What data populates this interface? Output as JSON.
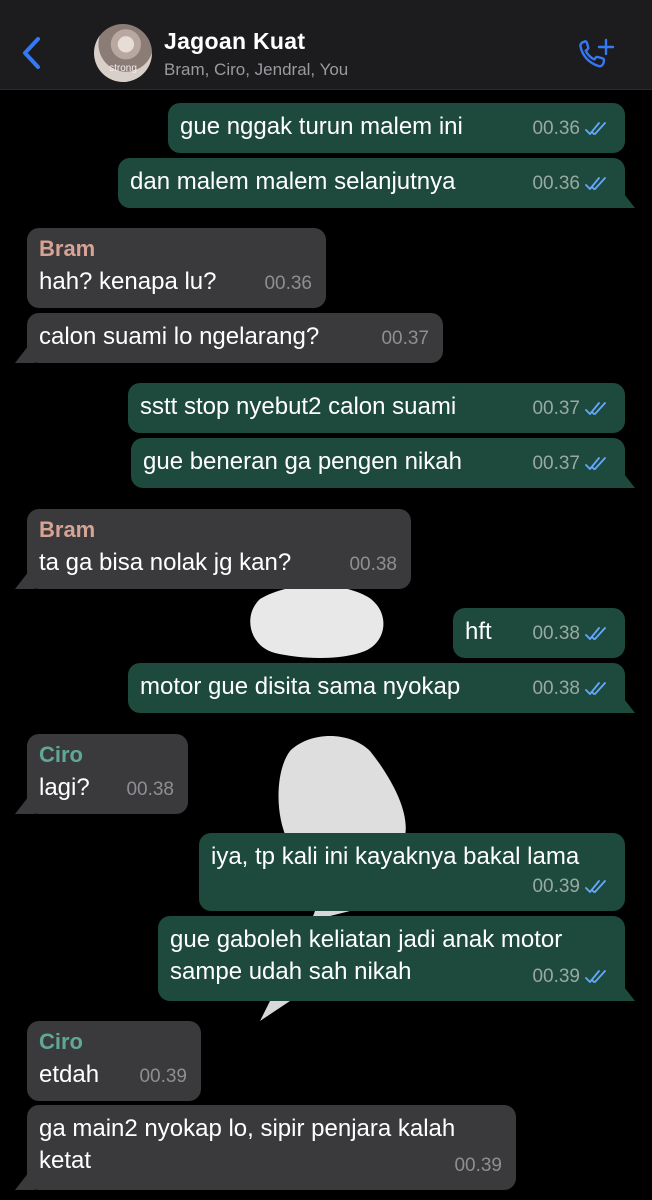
{
  "header": {
    "title": "Jagoan Kuat",
    "members": "Bram, Ciro, Jendral, You",
    "avatar_caption": "strong"
  },
  "colors": {
    "outgoing_bubble": "#1d4a3c",
    "incoming_bubble": "#3a3a3c",
    "accent_blue": "#3478f6",
    "bram_name": "#d6a394",
    "ciro_name": "#5fa896",
    "read_ticks": "#64a8ff"
  },
  "icons": {
    "back": "chevron-left-icon",
    "call": "phone-plus-icon",
    "read_receipt": "double-check-icon"
  },
  "messages": [
    {
      "dir": "out",
      "text": "gue nggak turun malem ini",
      "time": "00.36"
    },
    {
      "dir": "out",
      "text": "dan malem malem selanjutnya",
      "time": "00.36"
    },
    {
      "dir": "in",
      "sender": "Bram",
      "text": "hah? kenapa lu?",
      "time": "00.36"
    },
    {
      "dir": "in",
      "text": "calon suami lo ngelarang?",
      "time": "00.37"
    },
    {
      "dir": "out",
      "text": "sstt stop nyebut2 calon suami",
      "time": "00.37"
    },
    {
      "dir": "out",
      "text": "gue beneran ga pengen nikah",
      "time": "00.37"
    },
    {
      "dir": "in",
      "sender": "Bram",
      "text": "ta ga bisa nolak jg kan?",
      "time": "00.38"
    },
    {
      "dir": "out",
      "text": "hft",
      "time": "00.38"
    },
    {
      "dir": "out",
      "text": "motor gue disita sama nyokap",
      "time": "00.38"
    },
    {
      "dir": "in",
      "sender": "Ciro",
      "text": "lagi?",
      "time": "00.38"
    },
    {
      "dir": "out",
      "text": "iya, tp kali ini kayaknya bakal lama",
      "time": "00.39"
    },
    {
      "dir": "out",
      "text": "gue gaboleh keliatan jadi anak motor\nsampe udah sah nikah",
      "time": "00.39"
    },
    {
      "dir": "in",
      "sender": "Ciro",
      "text": "etdah",
      "time": "00.39"
    },
    {
      "dir": "in",
      "text": "ga main2 nyokap lo, sipir penjara kalah\nketat",
      "time": "00.39"
    }
  ]
}
